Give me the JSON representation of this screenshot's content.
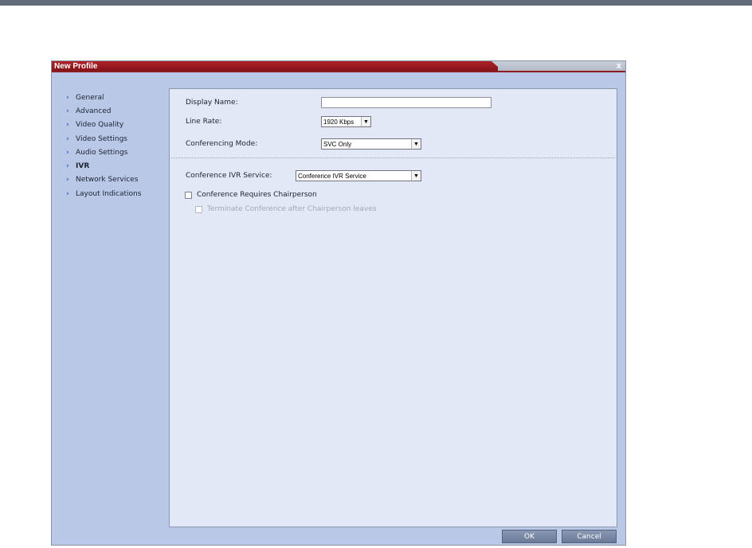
{
  "window": {
    "title": "New Profile",
    "close_glyph": "x"
  },
  "nav": {
    "items": [
      {
        "label": "General",
        "active": false
      },
      {
        "label": "Advanced",
        "active": false
      },
      {
        "label": "Video Quality",
        "active": false
      },
      {
        "label": "Video Settings",
        "active": false
      },
      {
        "label": "Audio Settings",
        "active": false
      },
      {
        "label": "IVR",
        "active": true
      },
      {
        "label": "Network Services",
        "active": false
      },
      {
        "label": "Layout Indications",
        "active": false
      }
    ],
    "arrow_glyph": "›"
  },
  "form": {
    "display_name_label": "Display Name:",
    "display_name_value": "",
    "line_rate_label": "Line Rate:",
    "line_rate_value": "1920 Kbps",
    "conferencing_mode_label": "Conferencing Mode:",
    "conferencing_mode_value": "SVC Only",
    "ivr_service_label": "Conference IVR Service:",
    "ivr_service_value": "Conference IVR Service",
    "requires_chairperson_label": "Conference Requires Chairperson",
    "requires_chairperson_checked": false,
    "terminate_label": "Terminate Conference after Chairperson leaves",
    "terminate_checked": false,
    "terminate_enabled": false,
    "dropdown_glyph": "▼"
  },
  "buttons": {
    "ok_label": "OK",
    "cancel_label": "Cancel"
  },
  "colors": {
    "title_red": "#a61d24",
    "dialog_bg": "#b9c8e6",
    "panel_bg": "#e3e8f7",
    "arrow_blue": "#2a66c8"
  }
}
